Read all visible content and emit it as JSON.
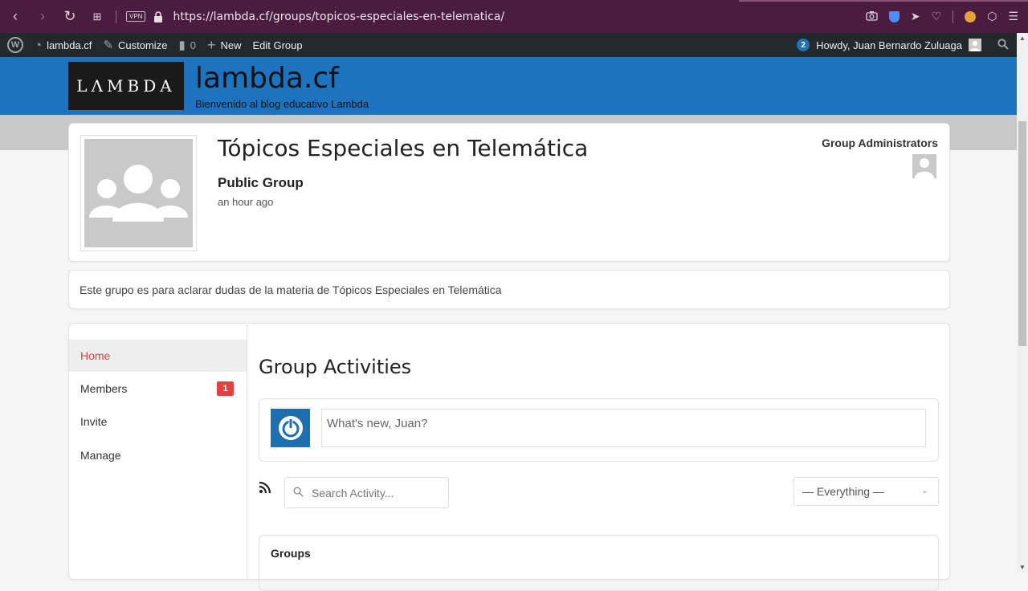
{
  "browser": {
    "url": "https://lambda.cf/groups/topicos-especiales-en-telematica/",
    "vpn_label": "VPN"
  },
  "adminbar": {
    "site_name": "lambda.cf",
    "customize": "Customize",
    "comments_count": "0",
    "new_label": "New",
    "edit_group": "Edit Group",
    "notifications": "2",
    "howdy": "Howdy, Juan Bernardo Zuluaga"
  },
  "site": {
    "logo_text": "LΛMBDA",
    "title": "lambda.cf",
    "tagline": "Bienvenido al blog educativo Lambda"
  },
  "group": {
    "title": "Tópicos Especiales en Telemática",
    "status": "Public Group",
    "last_active": "an hour ago",
    "admins_label": "Group Administrators",
    "description": "Este grupo es para aclarar dudas de la materia de Tópicos Especiales en Telemática"
  },
  "nav": {
    "items": [
      {
        "label": "Home"
      },
      {
        "label": "Members",
        "count": "1"
      },
      {
        "label": "Invite"
      },
      {
        "label": "Manage"
      }
    ]
  },
  "activity": {
    "title": "Group Activities",
    "post_placeholder": "What's new, Juan?",
    "search_placeholder": "Search Activity...",
    "filter_selected": "— Everything —",
    "first_item_label": "Groups"
  },
  "colors": {
    "accent": "#e2413f",
    "header_blue": "#1e73be",
    "browser_bar": "#4a1c3f",
    "adminbar": "#23282d"
  }
}
